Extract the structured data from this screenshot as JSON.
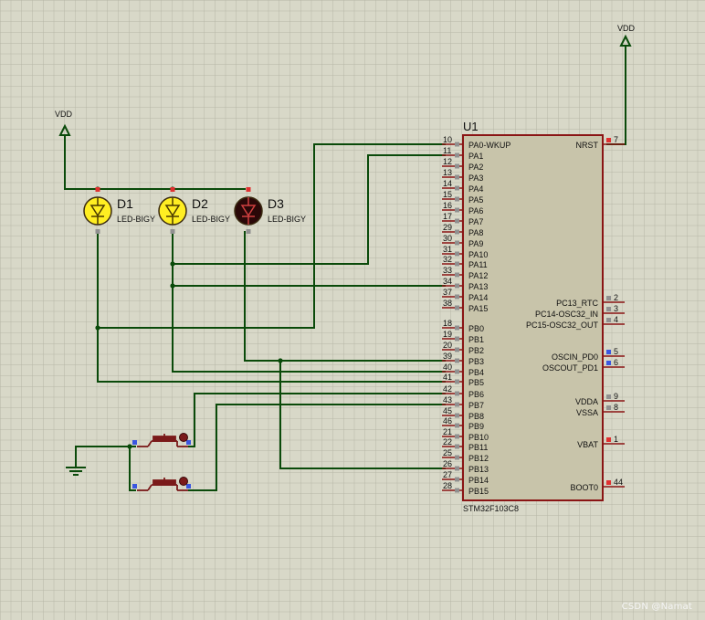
{
  "colors": {
    "background": "#d8d8c8",
    "grid": "#b6b6a6",
    "wire": "#0a4a0a",
    "chip_fill": "#c8c4aa",
    "chip_border": "#8a1414",
    "pin": "#8a1414",
    "led_on": "#ffee22",
    "led_off": "#2a0808",
    "button": "#7a1a1a"
  },
  "power": {
    "vdd_left": "VDD",
    "vdd_right": "VDD"
  },
  "leds": [
    {
      "ref": "D1",
      "value": "LED-BIGY",
      "state": "on"
    },
    {
      "ref": "D2",
      "value": "LED-BIGY",
      "state": "on"
    },
    {
      "ref": "D3",
      "value": "LED-BIGY",
      "state": "off"
    }
  ],
  "chip": {
    "ref": "U1",
    "part": "STM32F103C8",
    "left_pins": [
      {
        "num": "10",
        "name": "PA0-WKUP"
      },
      {
        "num": "11",
        "name": "PA1"
      },
      {
        "num": "12",
        "name": "PA2"
      },
      {
        "num": "13",
        "name": "PA3"
      },
      {
        "num": "14",
        "name": "PA4"
      },
      {
        "num": "15",
        "name": "PA5"
      },
      {
        "num": "16",
        "name": "PA6"
      },
      {
        "num": "17",
        "name": "PA7"
      },
      {
        "num": "29",
        "name": "PA8"
      },
      {
        "num": "30",
        "name": "PA9"
      },
      {
        "num": "31",
        "name": "PA10"
      },
      {
        "num": "32",
        "name": "PA11"
      },
      {
        "num": "33",
        "name": "PA12"
      },
      {
        "num": "34",
        "name": "PA13"
      },
      {
        "num": "37",
        "name": "PA14"
      },
      {
        "num": "38",
        "name": "PA15"
      },
      {
        "num": "18",
        "name": "PB0"
      },
      {
        "num": "19",
        "name": "PB1"
      },
      {
        "num": "20",
        "name": "PB2"
      },
      {
        "num": "39",
        "name": "PB3"
      },
      {
        "num": "40",
        "name": "PB4"
      },
      {
        "num": "41",
        "name": "PB5"
      },
      {
        "num": "42",
        "name": "PB6"
      },
      {
        "num": "43",
        "name": "PB7"
      },
      {
        "num": "45",
        "name": "PB8"
      },
      {
        "num": "46",
        "name": "PB9"
      },
      {
        "num": "21",
        "name": "PB10"
      },
      {
        "num": "22",
        "name": "PB11"
      },
      {
        "num": "25",
        "name": "PB12"
      },
      {
        "num": "26",
        "name": "PB13"
      },
      {
        "num": "27",
        "name": "PB14"
      },
      {
        "num": "28",
        "name": "PB15"
      }
    ],
    "right_pins": [
      {
        "num": "7",
        "name": "NRST"
      },
      {
        "num": "2",
        "name": "PC13_RTC"
      },
      {
        "num": "3",
        "name": "PC14-OSC32_IN"
      },
      {
        "num": "4",
        "name": "PC15-OSC32_OUT"
      },
      {
        "num": "5",
        "name": "OSCIN_PD0"
      },
      {
        "num": "6",
        "name": "OSCOUT_PD1"
      },
      {
        "num": "9",
        "name": "VDDA"
      },
      {
        "num": "8",
        "name": "VSSA"
      },
      {
        "num": "1",
        "name": "VBAT"
      },
      {
        "num": "44",
        "name": "BOOT0"
      }
    ]
  },
  "buttons": [
    {
      "id": "button-1"
    },
    {
      "id": "button-2"
    }
  ],
  "watermark": "CSDN @Namat"
}
